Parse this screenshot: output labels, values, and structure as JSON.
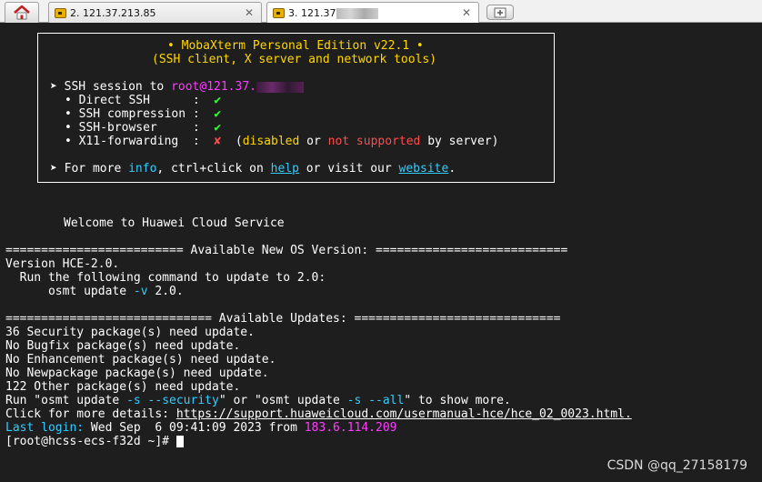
{
  "tabs": [
    {
      "title": "2. 121.37.213.85",
      "close": "✕"
    },
    {
      "title": "3. 121.37",
      "close": "✕"
    }
  ],
  "banner": {
    "title": "• MobaXterm Personal Edition v22.1 •",
    "subtitle": "(SSH client, X server and network tools)",
    "session_prefix": "➤ SSH session to ",
    "session_host": "root@121.37.",
    "features": [
      {
        "name": "• Direct SSH      :  ",
        "status": "✔"
      },
      {
        "name": "• SSH compression :  ",
        "status": "✔"
      },
      {
        "name": "• SSH-browser     :  ",
        "status": "✔"
      },
      {
        "name": "• X11-forwarding  :  ",
        "status": "✘"
      }
    ],
    "x11_open": "  (",
    "x11_disabled": "disabled",
    "x11_or": " or ",
    "x11_not_supported": "not supported",
    "x11_close": " by server)",
    "more_prefix": "➤ For more ",
    "more_info": "info",
    "more_middle": ", ctrl+click on ",
    "more_help": "help",
    "more_visit": " or visit our ",
    "more_website": "website",
    "more_end": "."
  },
  "welcome": "Welcome to Huawei Cloud Service",
  "os_header": "========================= Available New OS Version: ===========================",
  "os_lines": {
    "l1": "Version HCE-2.0.",
    "l2": "  Run the following command to update to 2.0:",
    "l3_cmd": "      osmt update ",
    "l3_flag": "-v",
    "l3_end": " 2.0."
  },
  "updates_header": "============================= Available Updates: =============================",
  "updates": [
    "36 Security package(s) need update.",
    "No Bugfix package(s) need update.",
    "No Enhancement package(s) need update.",
    "No Newpackage package(s) need update.",
    "122 Other package(s) need update."
  ],
  "run_line": {
    "p1": "Run \"osmt update ",
    "f1": "-s --security",
    "p2": "\" or \"osmt update ",
    "f2": "-s --all",
    "p3": "\" to show more."
  },
  "details": {
    "prefix": "Click for more details: ",
    "url": "https://support.huaweicloud.com/usermanual-hce/hce_02_0023.html."
  },
  "last_login": {
    "label": "Last login:",
    "date": " Wed Sep  6 09:41:09 2023 from ",
    "ip": "183.6.114.209"
  },
  "prompt": "[root@hcss-ecs-f32d ~]# ",
  "watermark": "CSDN @qq_27158179",
  "colors": {
    "background": "#1e1e1e",
    "yellow": "#ffd700",
    "magenta": "#ff3cff",
    "green": "#33ff33",
    "red": "#ff4c4c",
    "cyan": "#33ccff"
  }
}
